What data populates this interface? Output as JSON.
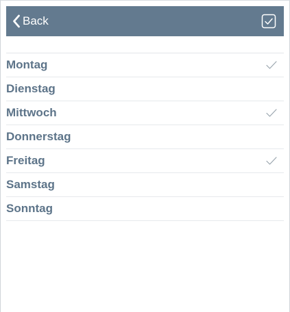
{
  "header": {
    "back_label": "Back",
    "back_icon": "chevron-left-icon",
    "confirm_icon": "checkbox-check-icon"
  },
  "colors": {
    "header_bg": "#637a8f",
    "text": "#5d7489",
    "check": "#9aa5ae"
  },
  "days": [
    {
      "label": "Montag",
      "checked": true
    },
    {
      "label": "Dienstag",
      "checked": false
    },
    {
      "label": "Mittwoch",
      "checked": true
    },
    {
      "label": "Donnerstag",
      "checked": false
    },
    {
      "label": "Freitag",
      "checked": true
    },
    {
      "label": "Samstag",
      "checked": false
    },
    {
      "label": "Sonntag",
      "checked": false
    }
  ]
}
